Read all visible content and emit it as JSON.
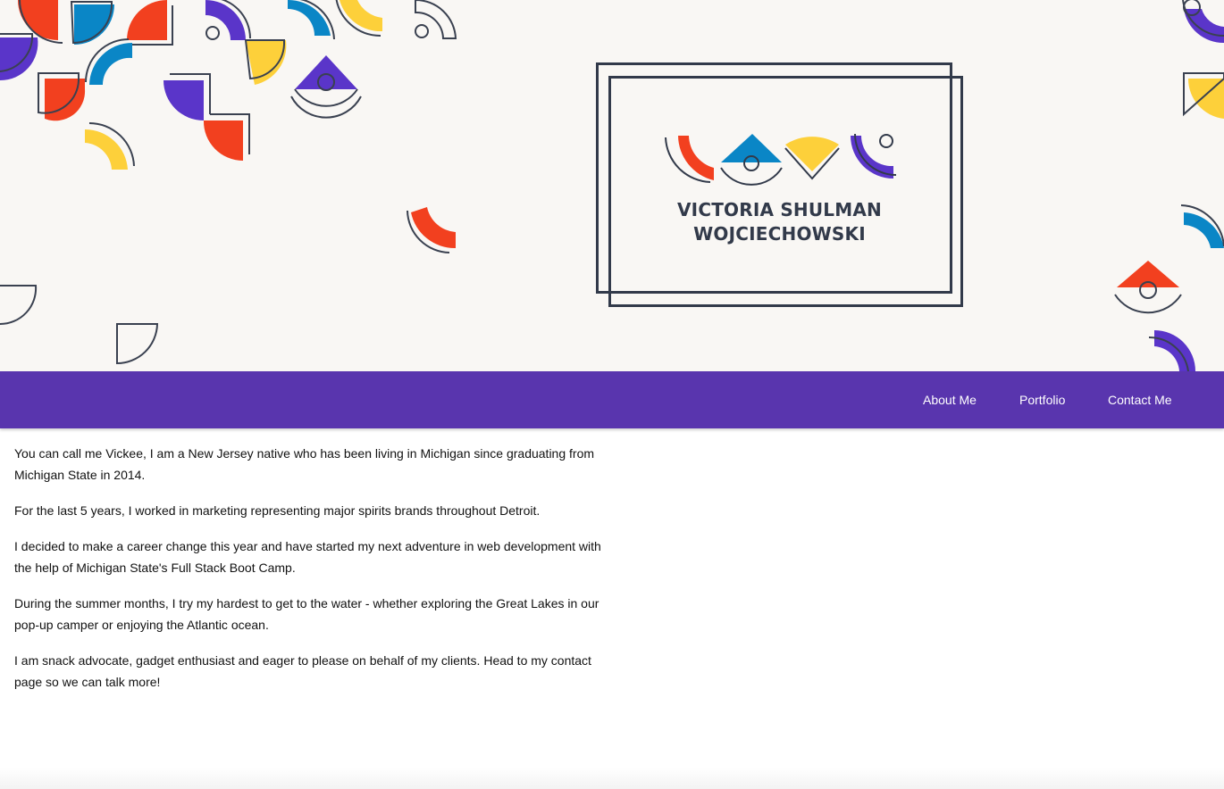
{
  "header": {
    "logo_line1": "VICTORIA SHULMAN",
    "logo_line2": "WOJCIECHOWSKI"
  },
  "nav": {
    "items": [
      {
        "label": "About Me"
      },
      {
        "label": "Portfolio"
      },
      {
        "label": "Contact Me"
      }
    ]
  },
  "about": {
    "paragraphs": [
      "You can call me Vickee, I am a New Jersey native who has been living in Michigan since graduating from Michigan State in 2014.",
      "For the last 5 years, I worked in marketing representing major spirits brands throughout Detroit.",
      "I decided to make a career change this year and have started my next adventure in web development with the help of Michigan State's Full Stack Boot Camp.",
      "During the summer months, I try my hardest to get to the water - whether exploring the Great Lakes in our pop-up camper or enjoying the Atlantic ocean.",
      "I am snack advocate, gadget enthusiast and eager to please on behalf of my clients. Head to my contact page so we can talk more!"
    ]
  },
  "colors": {
    "nav_bg": "#5935ae",
    "red": "#f2401f",
    "blue": "#0a86c6",
    "yellow": "#fdd03a",
    "purple": "#5a35c9",
    "outline": "#3a4150"
  }
}
